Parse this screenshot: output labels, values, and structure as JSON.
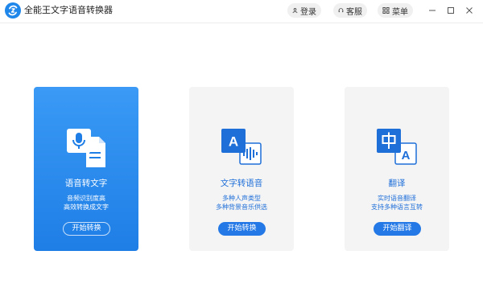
{
  "app": {
    "title": "全能王文字语音转换器",
    "icon": "refresh-logo-icon"
  },
  "header": {
    "login_label": "登录",
    "service_label": "客服",
    "menu_label": "菜单"
  },
  "window_controls": {
    "minimize": "minimize-icon",
    "maximize": "maximize-icon",
    "close": "close-icon"
  },
  "cards": [
    {
      "title": "语音转文字",
      "desc": [
        "音频识别度高",
        "高效转换成文字"
      ],
      "button": "开始转换",
      "icon": "mic-document-icon",
      "active": true
    },
    {
      "title": "文字转语音",
      "desc": [
        "多种人声类型",
        "多种背景音乐供选"
      ],
      "button": "开始转换",
      "icon": "text-to-audio-icon",
      "active": false
    },
    {
      "title": "翻译",
      "desc": [
        "实时语音翻译",
        "支持多种语言互转"
      ],
      "button": "开始翻译",
      "icon": "translate-icon",
      "active": false
    }
  ],
  "colors": {
    "accent": "#2479e6",
    "active_card_top": "#3a9af5",
    "active_card_bottom": "#1f7ee6",
    "inactive_card": "#f4f4f4"
  }
}
